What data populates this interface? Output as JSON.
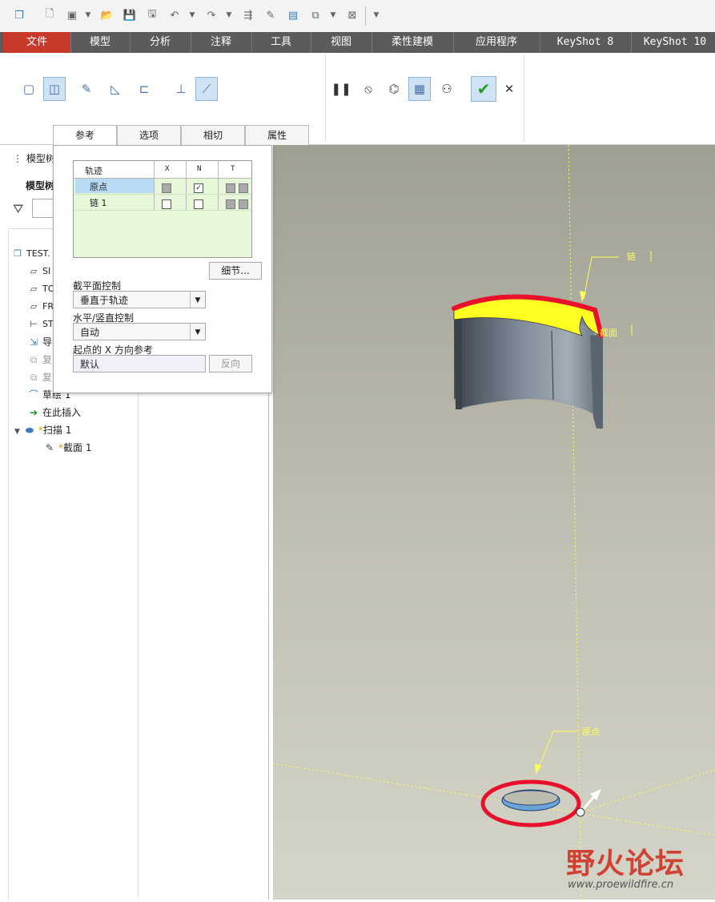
{
  "ribbon": {
    "tabs": [
      {
        "label": "文件",
        "active": true
      },
      {
        "label": "模型"
      },
      {
        "label": "分析"
      },
      {
        "label": "注释"
      },
      {
        "label": "工具"
      },
      {
        "label": "视图"
      },
      {
        "label": "柔性建模"
      },
      {
        "label": "应用程序"
      },
      {
        "label": "KeyShot 8"
      },
      {
        "label": "KeyShot 10"
      }
    ],
    "subtabs": [
      "参考",
      "选项",
      "相切",
      "属性"
    ]
  },
  "tree": {
    "header": "模型树",
    "title": "模型树",
    "items": [
      {
        "label": "TEST.",
        "icon": "part-icon"
      },
      {
        "label": "SI",
        "icon": "plane-icon"
      },
      {
        "label": "TO",
        "icon": "plane-icon"
      },
      {
        "label": "FR",
        "icon": "plane-icon"
      },
      {
        "label": "ST",
        "icon": "csys-icon"
      },
      {
        "label": "导",
        "icon": "import-icon"
      },
      {
        "label": "复",
        "icon": "copy-icon"
      },
      {
        "label": "复",
        "icon": "copy-icon"
      },
      {
        "label": "草绘 1",
        "icon": "sketch-icon"
      },
      {
        "label": "在此插入",
        "icon": "insert-arrow-icon"
      },
      {
        "label": "扫描 1",
        "icon": "sweep-icon"
      },
      {
        "label": "截面 1",
        "icon": "section-icon"
      }
    ]
  },
  "refs": {
    "table": {
      "headers": [
        "轨迹",
        "X",
        "N",
        "T"
      ],
      "rows": [
        {
          "name": "原点",
          "x": "gray",
          "n": "checked",
          "t": "gray"
        },
        {
          "name": "链 1",
          "x": "empty",
          "n": "empty",
          "t": "gray"
        }
      ]
    },
    "details_button": "细节...",
    "section_plane_label": "截平面控制",
    "section_plane_value": "垂直于轨迹",
    "hv_label": "水平/竖直控制",
    "hv_value": "自动",
    "xdir_label": "起点的 X 方向参考",
    "xdir_value": "默认",
    "flip_button": "反向"
  },
  "graphics": {
    "labels": {
      "chain": "链",
      "section": "截面",
      "origin": "原点"
    }
  },
  "watermark": {
    "title": "野火论坛",
    "url": "www.proewildfire.cn"
  },
  "colors": {
    "tab_active": "#c9392b",
    "highlight_red": "#e8102a",
    "highlight_yellow": "#ffff00",
    "panel_green": "#e6f7da",
    "row_selected": "#b9daf5"
  }
}
